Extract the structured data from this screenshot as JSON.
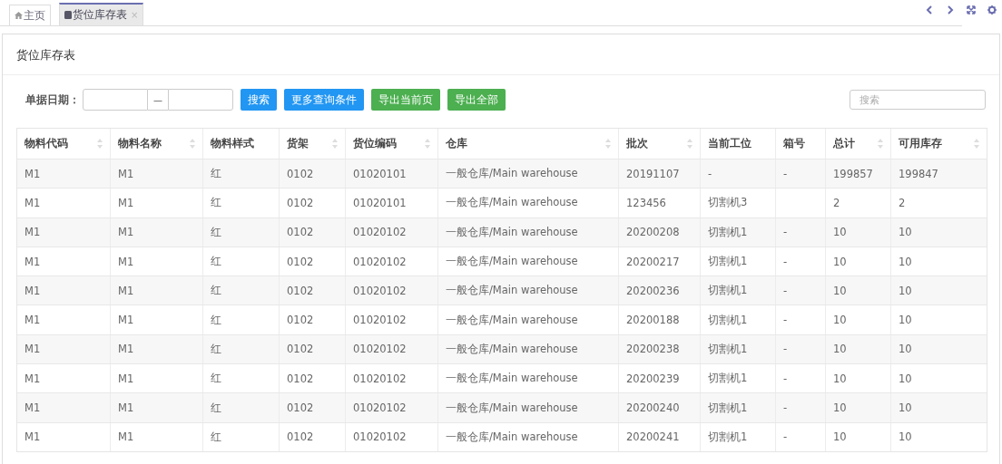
{
  "tabs": [
    {
      "label": "主页",
      "selected": false
    },
    {
      "label": "货位库存表",
      "selected": true,
      "close": "×"
    }
  ],
  "panel": {
    "title": "货位库存表"
  },
  "filter": {
    "label": "单据日期：",
    "separator": "—",
    "search_placeholder": "搜索"
  },
  "buttons": [
    {
      "label": "搜索",
      "kind": "primary"
    },
    {
      "label": "更多查询条件",
      "kind": "primary"
    },
    {
      "label": "导出当前页",
      "kind": "success"
    },
    {
      "label": "导出全部",
      "kind": "success"
    }
  ],
  "table": {
    "columns": [
      {
        "label": "物料代码",
        "sortable": true
      },
      {
        "label": "物料名称",
        "sortable": true
      },
      {
        "label": "物料样式",
        "sortable": false
      },
      {
        "label": "货架",
        "sortable": true
      },
      {
        "label": "货位编码",
        "sortable": true
      },
      {
        "label": "仓库",
        "sortable": true
      },
      {
        "label": "批次",
        "sortable": true
      },
      {
        "label": "当前工位",
        "sortable": false
      },
      {
        "label": "箱号",
        "sortable": false
      },
      {
        "label": "总计",
        "sortable": true
      },
      {
        "label": "可用库存",
        "sortable": true
      }
    ],
    "rows": [
      {
        "cells": [
          "M1",
          "M1",
          "红",
          "0102",
          "01020101",
          "一般仓库/Main warehouse",
          "20191107",
          "-",
          "-",
          "199857",
          "199847"
        ]
      },
      {
        "cells": [
          "M1",
          "M1",
          "红",
          "0102",
          "01020101",
          "一般仓库/Main warehouse",
          "123456",
          "切割机3",
          null,
          "2",
          "2"
        ]
      },
      {
        "cells": [
          "M1",
          "M1",
          "红",
          "0102",
          "01020102",
          "一般仓库/Main warehouse",
          "20200208",
          "切割机1",
          "-",
          "10",
          "10"
        ]
      },
      {
        "cells": [
          "M1",
          "M1",
          "红",
          "0102",
          "01020102",
          "一般仓库/Main warehouse",
          "20200217",
          "切割机1",
          "-",
          "10",
          "10"
        ]
      },
      {
        "cells": [
          "M1",
          "M1",
          "红",
          "0102",
          "01020102",
          "一般仓库/Main warehouse",
          "20200236",
          "切割机1",
          "-",
          "10",
          "10"
        ]
      },
      {
        "cells": [
          "M1",
          "M1",
          "红",
          "0102",
          "01020102",
          "一般仓库/Main warehouse",
          "20200188",
          "切割机1",
          "-",
          "10",
          "10"
        ]
      },
      {
        "cells": [
          "M1",
          "M1",
          "红",
          "0102",
          "01020102",
          "一般仓库/Main warehouse",
          "20200238",
          "切割机1",
          "-",
          "10",
          "10"
        ]
      },
      {
        "cells": [
          "M1",
          "M1",
          "红",
          "0102",
          "01020102",
          "一般仓库/Main warehouse",
          "20200239",
          "切割机1",
          "-",
          "10",
          "10"
        ]
      },
      {
        "cells": [
          "M1",
          "M1",
          "红",
          "0102",
          "01020102",
          "一般仓库/Main warehouse",
          "20200240",
          "切割机1",
          "-",
          "10",
          "10"
        ]
      },
      {
        "cells": [
          "M1",
          "M1",
          "红",
          "0102",
          "01020102",
          "一般仓库/Main warehouse",
          "20200241",
          "切割机1",
          "-",
          "10",
          "10"
        ]
      }
    ]
  }
}
